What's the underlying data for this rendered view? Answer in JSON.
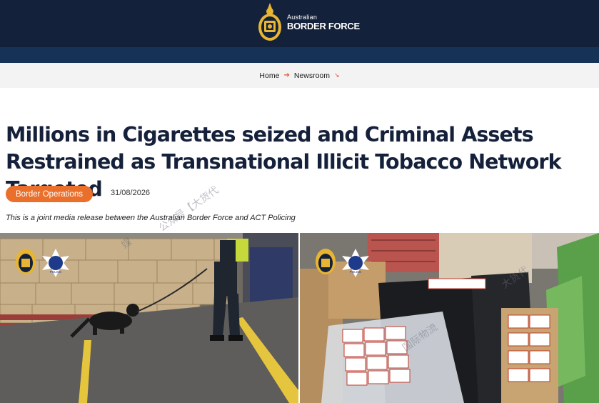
{
  "header": {
    "logo_small": "Australian",
    "logo_big": "BORDER FORCE",
    "brand_color": "#14213a",
    "subbar_color": "#163257"
  },
  "breadcrumb": {
    "home": "Home",
    "newsroom": "Newsroom",
    "separator_icon": "arrow-right-icon",
    "dropdown_icon": "arrow-down-right-icon"
  },
  "article": {
    "title": "Millions in Cigarettes seized and Criminal Assets Restrained as Transnational Illicit Tobacco Network Targeted",
    "category": "Border Operations",
    "date": "31/08/2026",
    "lead": "This is a joint media release between the Australian Border Force and ACT Policing",
    "accent_color": "#ea6f2a"
  },
  "photos": {
    "left": {
      "badge_text": "POLICE"
    },
    "right": {
      "badge_text": "POLICE"
    }
  },
  "watermarks": {
    "left": "公众号【大货代",
    "left_prefix": "媒",
    "right_top": "大货代",
    "right_mid": "国际物流"
  }
}
